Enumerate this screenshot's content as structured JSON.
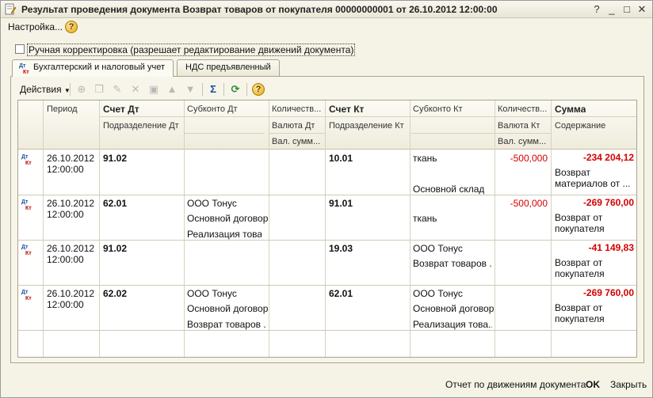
{
  "window": {
    "title": "Результат проведения документа Возврат товаров от покупателя 00000000001 от 26.10.2012 12:00:00",
    "controls": {
      "help": "?",
      "minimize": "_",
      "maximize": "□",
      "close": "✕"
    }
  },
  "menubar": {
    "settings_label": "Настройка...",
    "help_label": "?"
  },
  "manual_correction": {
    "label": "Ручная корректировка (разрешает редактирование движений документа)",
    "checked": false
  },
  "tabs": [
    {
      "label": "Бухгалтерский и налоговый учет",
      "active": true
    },
    {
      "label": "НДС предъявленный",
      "active": false
    }
  ],
  "toolbar": {
    "actions_label": "Действия",
    "help_label": "?"
  },
  "table": {
    "headers": {
      "row1": [
        "Период",
        "Счет Дт",
        "Субконто Дт",
        "Количеств...",
        "Счет Кт",
        "Субконто Кт",
        "Количеств...",
        "Сумма"
      ],
      "row2": [
        "Подразделение Дт",
        "Валюта Дт",
        "Подразделение Кт",
        "Валюта Кт",
        "Содержание"
      ],
      "row3": [
        "Вал. сумм...",
        "Вал. сумм..."
      ]
    },
    "rows": [
      {
        "date": "26.10.2012",
        "time": "12:00:00",
        "acc_dt": "91.02",
        "sub_dt": [
          "",
          "",
          ""
        ],
        "acc_kt": "10.01",
        "sub_kt": [
          "ткань",
          "",
          "Основной склад"
        ],
        "qty_kt": "-500,000",
        "sum": "-234 204,12",
        "content": [
          "Возврат",
          "материалов от ..."
        ]
      },
      {
        "date": "26.10.2012",
        "time": "12:00:00",
        "acc_dt": "62.01",
        "sub_dt": [
          "ООО Тонус",
          "Основной договор",
          "Реализация това..."
        ],
        "acc_kt": "91.01",
        "sub_kt": [
          "",
          "ткань",
          ""
        ],
        "qty_kt": "-500,000",
        "sum": "-269 760,00",
        "content": [
          "Возврат от",
          "покупателя"
        ]
      },
      {
        "date": "26.10.2012",
        "time": "12:00:00",
        "acc_dt": "91.02",
        "sub_dt": [
          "",
          "",
          ""
        ],
        "acc_kt": "19.03",
        "sub_kt": [
          "ООО Тонус",
          "Возврат товаров ...",
          ""
        ],
        "qty_kt": "",
        "sum": "-41 149,83",
        "content": [
          "Возврат от",
          "покупателя"
        ]
      },
      {
        "date": "26.10.2012",
        "time": "12:00:00",
        "acc_dt": "62.02",
        "sub_dt": [
          "ООО Тонус",
          "Основной договор",
          "Возврат товаров ..."
        ],
        "acc_kt": "62.01",
        "sub_kt": [
          "ООО Тонус",
          "Основной договор",
          "Реализация това..."
        ],
        "qty_kt": "",
        "sum": "-269 760,00",
        "content": [
          "Возврат от",
          "покупателя"
        ]
      }
    ]
  },
  "footer": {
    "report_label": "Отчет по движениям документа",
    "ok_label": "OK",
    "close_label": "Закрыть"
  },
  "colors": {
    "negative": "#d40000",
    "background": "#f5f3e6"
  }
}
